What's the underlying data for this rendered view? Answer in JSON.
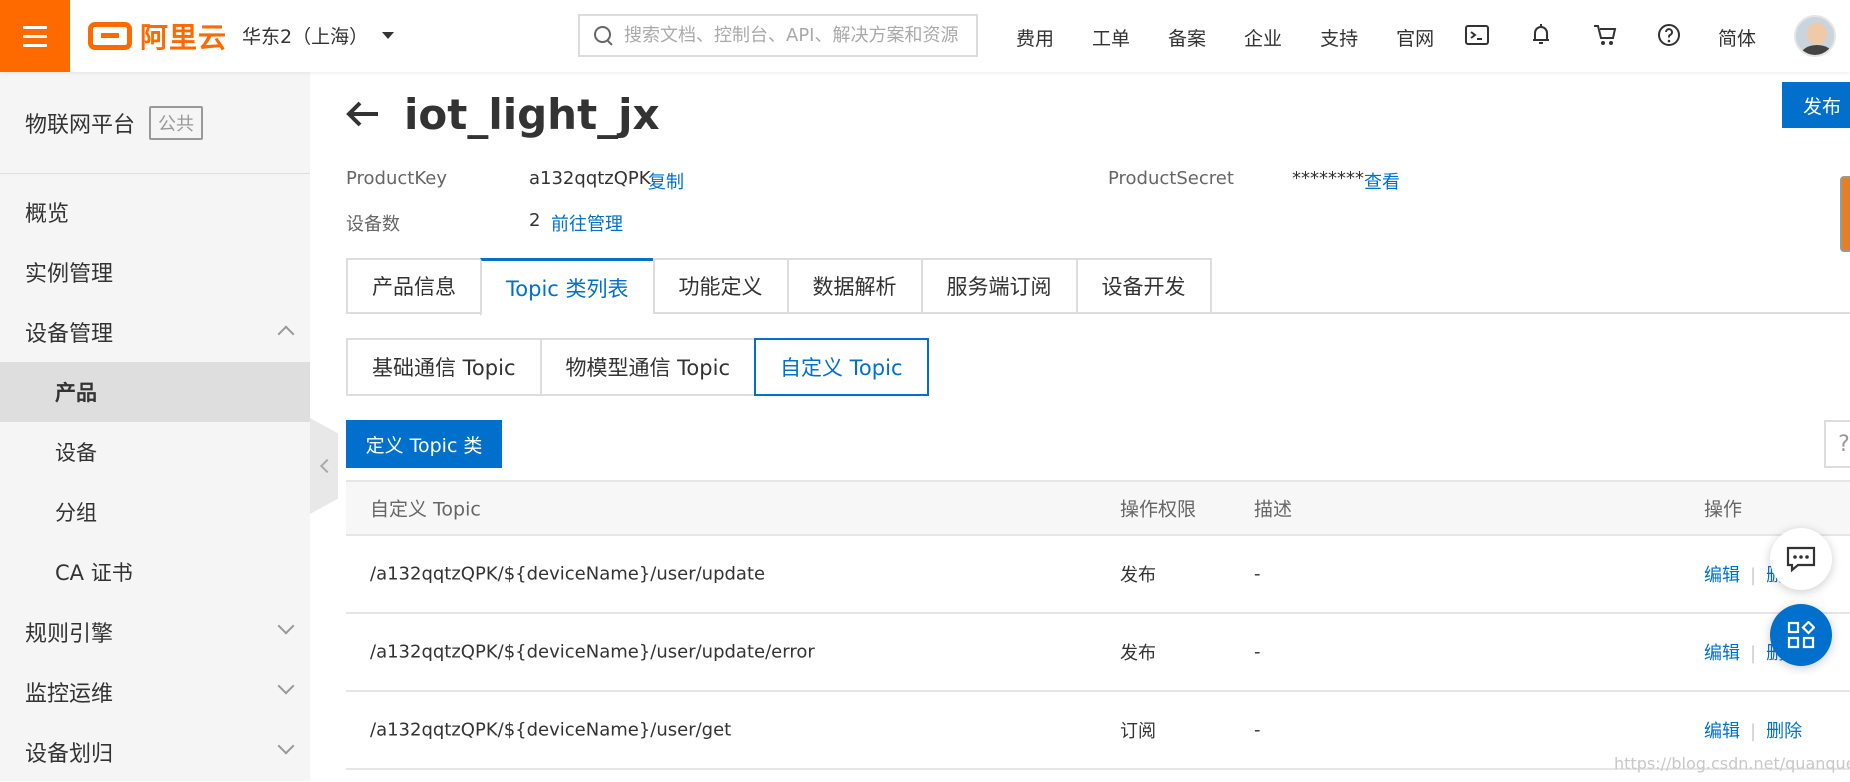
{
  "topbar": {
    "logo_text": "阿里云",
    "region": "华东2（上海）",
    "search_placeholder": "搜索文档、控制台、API、解决方案和资源",
    "nav": [
      "费用",
      "工单",
      "备案",
      "企业",
      "支持",
      "官网"
    ],
    "lang": "简体"
  },
  "sidebar": {
    "title": "物联网平台",
    "badge": "公共",
    "items": [
      {
        "label": "概览"
      },
      {
        "label": "实例管理"
      },
      {
        "label": "设备管理"
      },
      {
        "label": "产品"
      },
      {
        "label": "设备"
      },
      {
        "label": "分组"
      },
      {
        "label": "CA 证书"
      },
      {
        "label": "规则引擎"
      },
      {
        "label": "监控运维"
      },
      {
        "label": "设备划归"
      }
    ]
  },
  "header": {
    "title": "iot_light_jx",
    "publish": "发布"
  },
  "meta": {
    "product_key_label": "ProductKey",
    "product_key_value": "a132qqtzQPK",
    "copy": "复制",
    "product_secret_label": "ProductSecret",
    "product_secret_value": "********",
    "view": "查看",
    "device_count_label": "设备数",
    "device_count_value": "2",
    "manage": "前往管理"
  },
  "tabs": [
    "产品信息",
    "Topic 类列表",
    "功能定义",
    "数据解析",
    "服务端订阅",
    "设备开发"
  ],
  "subtabs": [
    "基础通信 Topic",
    "物模型通信 Topic",
    "自定义 Topic"
  ],
  "define_button": "定义 Topic 类",
  "help": "?",
  "table": {
    "headers": [
      "自定义 Topic",
      "操作权限",
      "描述",
      "操作"
    ],
    "rows": [
      {
        "topic": "/a132qqtzQPK/${deviceName}/user/update",
        "perm": "发布",
        "desc": "-",
        "edit": "编辑",
        "del": "删除"
      },
      {
        "topic": "/a132qqtzQPK/${deviceName}/user/update/error",
        "perm": "发布",
        "desc": "-",
        "edit": "编辑",
        "del": "删除"
      },
      {
        "topic": "/a132qqtzQPK/${deviceName}/user/get",
        "perm": "订阅",
        "desc": "-",
        "edit": "编辑",
        "del": "删除"
      }
    ]
  },
  "watermark": "https://blog.csdn.net/quanqueen",
  "colors": {
    "brand": "#ff6a00",
    "primary": "#0070cc"
  }
}
